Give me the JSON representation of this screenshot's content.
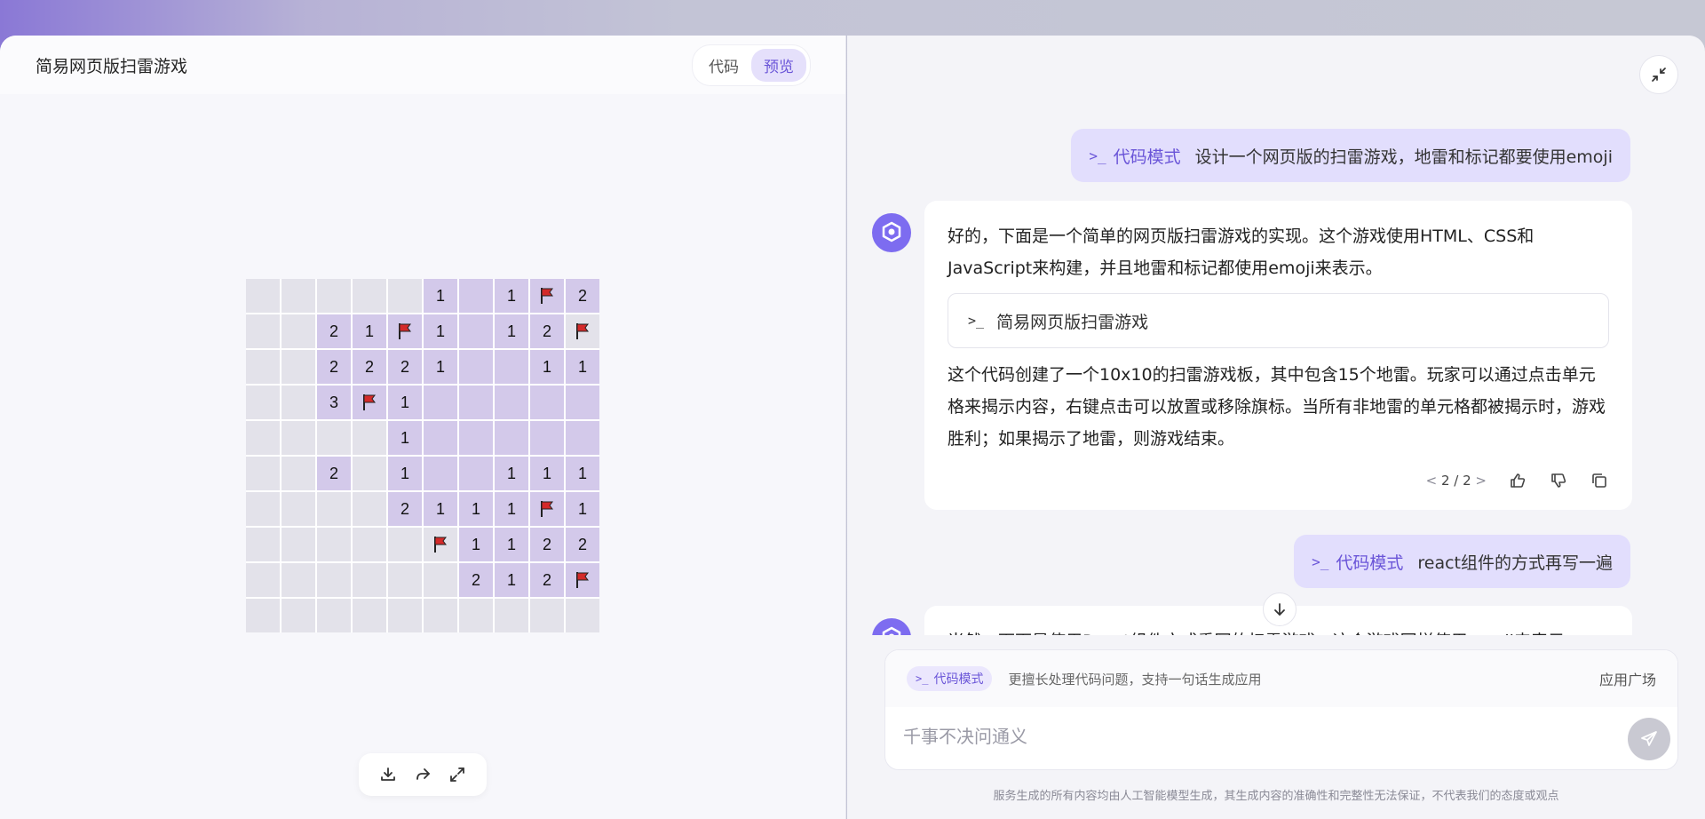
{
  "preview": {
    "title": "简易网页版扫雷游戏",
    "tabs": [
      {
        "label": "代码",
        "active": false
      },
      {
        "label": "预览",
        "active": true
      }
    ],
    "board": [
      [
        "",
        "",
        "",
        "",
        "",
        "1",
        "r",
        "1",
        "F",
        "2"
      ],
      [
        "",
        "",
        "2",
        "1",
        "F",
        "1",
        "r",
        "1",
        "2",
        "Fh"
      ],
      [
        "",
        "",
        "2",
        "2",
        "2",
        "1",
        "r",
        "r",
        "1",
        "1"
      ],
      [
        "",
        "",
        "3",
        "F",
        "1",
        "r",
        "r",
        "r",
        "r",
        "r"
      ],
      [
        "",
        "",
        "",
        "",
        "1",
        "r",
        "r",
        "r",
        "r",
        "r"
      ],
      [
        "",
        "",
        "2",
        "",
        "1",
        "r",
        "r",
        "1",
        "1",
        "1"
      ],
      [
        "",
        "",
        "",
        "",
        "2",
        "1",
        "1",
        "1",
        "F",
        "1"
      ],
      [
        "",
        "",
        "",
        "",
        "",
        "Fh",
        "1",
        "1",
        "2",
        "2"
      ],
      [
        "",
        "",
        "",
        "",
        "",
        "",
        "2",
        "1",
        "2",
        "F"
      ],
      [
        "",
        "",
        "",
        "",
        "",
        "",
        "",
        "",
        "",
        ""
      ]
    ],
    "toolbar": [
      "download-icon",
      "share-icon",
      "fullscreen-icon"
    ]
  },
  "chat": {
    "messages": [
      {
        "role": "user",
        "mode": "代码模式",
        "text": "设计一个网页版的扫雷游戏，地雷和标记都要使用emoji"
      },
      {
        "role": "assistant",
        "intro": "好的，下面是一个简单的网页版扫雷游戏的实现。这个游戏使用HTML、CSS和JavaScript来构建，并且地雷和标记都使用emoji来表示。",
        "artifact": "简易网页版扫雷游戏",
        "body": "这个代码创建了一个10x10的扫雷游戏板，其中包含15个地雷。玩家可以通过点击单元格来揭示内容，右键点击可以放置或移除旗标。当所有非地雷的单元格都被揭示时，游戏胜利；如果揭示了地雷，则游戏结束。",
        "pager": "2 / 2"
      },
      {
        "role": "user",
        "mode": "代码模式",
        "text": "react组件的方式再写一遍"
      }
    ],
    "partial_text": "当然，下面是使用React组件方式重写的扫雷游戏。这个游戏同样使用emoji来表示"
  },
  "composer": {
    "mode_label": "代码模式",
    "mode_hint": "更擅长处理代码问题，支持一句话生成应用",
    "app_square": "应用广场",
    "placeholder": "千事不决问通义"
  },
  "footer": {
    "disclaimer": "服务生成的所有内容均由人工智能模型生成，其生成内容的准确性和完整性无法保证，不代表我们的态度或观点"
  },
  "colors": {
    "accent": "#6a55d8",
    "revealed": "#d3c9ea",
    "hidden": "#e3e2ea",
    "flag": "#d42a2a"
  }
}
